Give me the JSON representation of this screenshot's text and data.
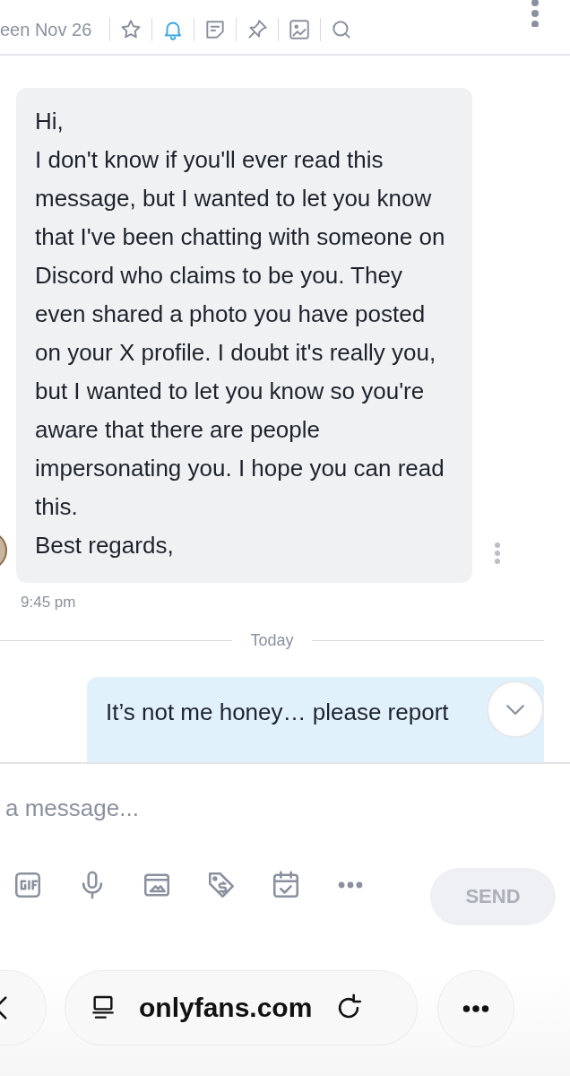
{
  "header": {
    "last_seen": "een Nov 26",
    "notifications_on": true
  },
  "messages": [
    {
      "kind": "incoming",
      "paragraphs": [
        "Hi,",
        "I don't know if you'll ever read this message, but I wanted to let you know that I've been chatting with someone on Discord who claims to be you. They even shared a photo you have posted on your X profile. I doubt it's really you, but I wanted to let you know so you're aware that there are people impersonating you. I hope you can read this.",
        "Best regards,"
      ],
      "time": "9:45 pm"
    },
    {
      "kind": "divider",
      "label": "Today"
    },
    {
      "kind": "outgoing",
      "paragraphs": [
        "It’s not me honey… please report"
      ]
    }
  ],
  "composer": {
    "placeholder": "a message...",
    "send": "SEND"
  },
  "browser": {
    "url": "onlyfans.com"
  }
}
